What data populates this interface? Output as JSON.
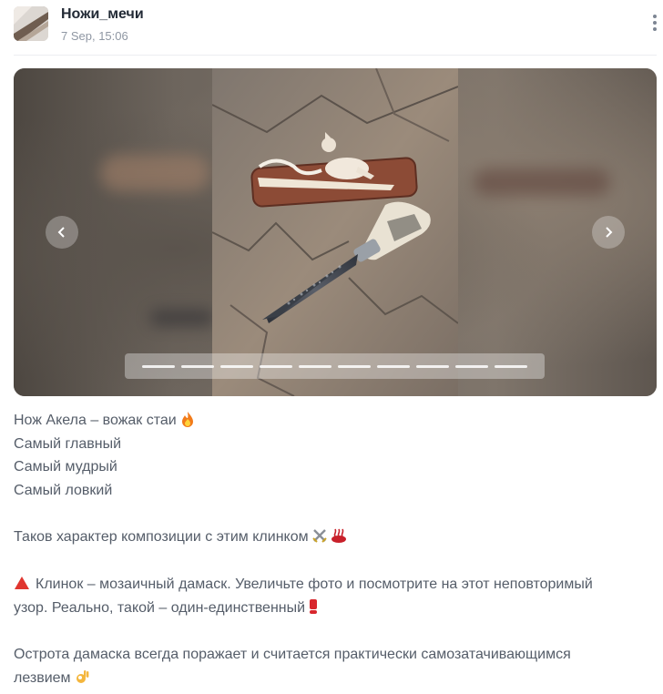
{
  "post": {
    "author": "Ножи_мечи",
    "time": "7 Sep, 15:06"
  },
  "gallery": {
    "slide_count": 10,
    "active_slide": 1
  },
  "text": {
    "l1": "Нож Акела – вожак стаи",
    "l2": "Самый главный",
    "l3": "Самый мудрый",
    "l4": "Самый ловкий",
    "l5": "Таков характер композиции с этим клинком",
    "l6a": "Клинок – мозаичный дамаск. Увеличьте фото и посмотрите на этот неповторимый",
    "l6b": "узор. Реально, такой – один-единственный",
    "l7a": "Острота дамаска всегда поражает и считается практически самозатачивающимся",
    "l7b": "лезвием"
  },
  "icons": {
    "l1_emoji": "fire-icon",
    "l5_emoji_1": "crossed-swords-icon",
    "l5_emoji_2": "hot-springs-icon",
    "l6_emoji_start": "red-triangle-icon",
    "l6_emoji_end": "exclamation-icon",
    "l7_emoji": "ok-hand-icon",
    "menu": "more-vertical-icon",
    "prev": "chevron-left-icon",
    "next": "chevron-right-icon"
  },
  "colors": {
    "author": "#222a35",
    "time": "#8f97a3",
    "body_text": "#555d69"
  }
}
